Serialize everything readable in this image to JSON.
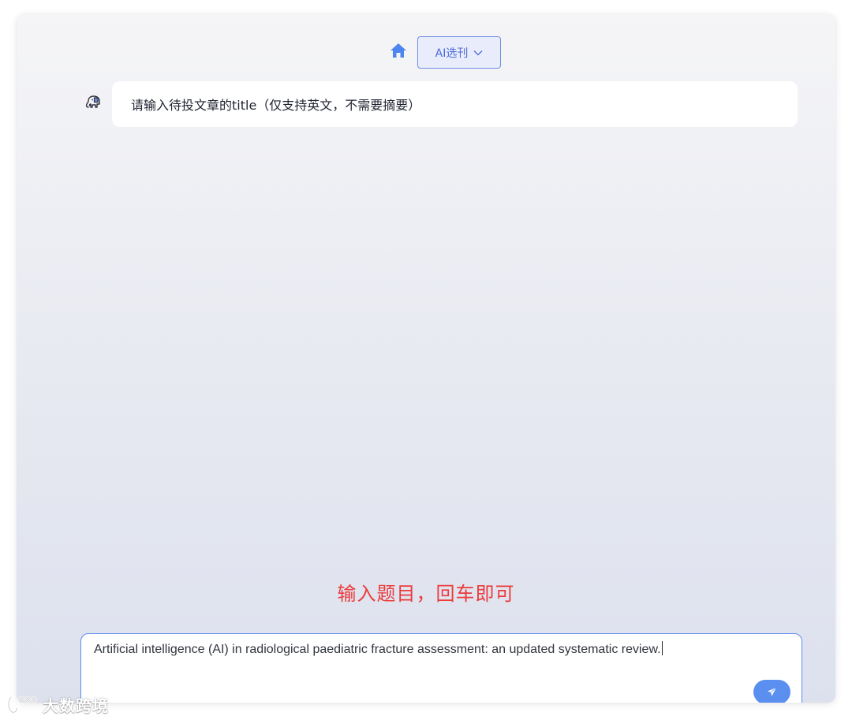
{
  "header": {
    "home_icon": "home-icon",
    "mode_select": {
      "selected": "AI选刊",
      "icon": "chevron-down-icon"
    }
  },
  "chat": {
    "bot_avatar_icon": "elephant-avatar-icon",
    "messages": [
      {
        "role": "bot",
        "text": "请输入待投文章的title（仅支持英文，不需要摘要）"
      }
    ]
  },
  "annotation": {
    "text": "输入题目，回车即可",
    "color": "#ec3b3b"
  },
  "composer": {
    "value": "Artificial intelligence (AI) in radiological paediatric fracture assessment: an updated systematic review.",
    "send_icon": "paper-plane-icon"
  },
  "watermark": {
    "text": "大数跨境"
  },
  "colors": {
    "accent": "#5a8ff0",
    "select_border": "#6f8fe6",
    "select_bg": "#e9ecfb"
  }
}
